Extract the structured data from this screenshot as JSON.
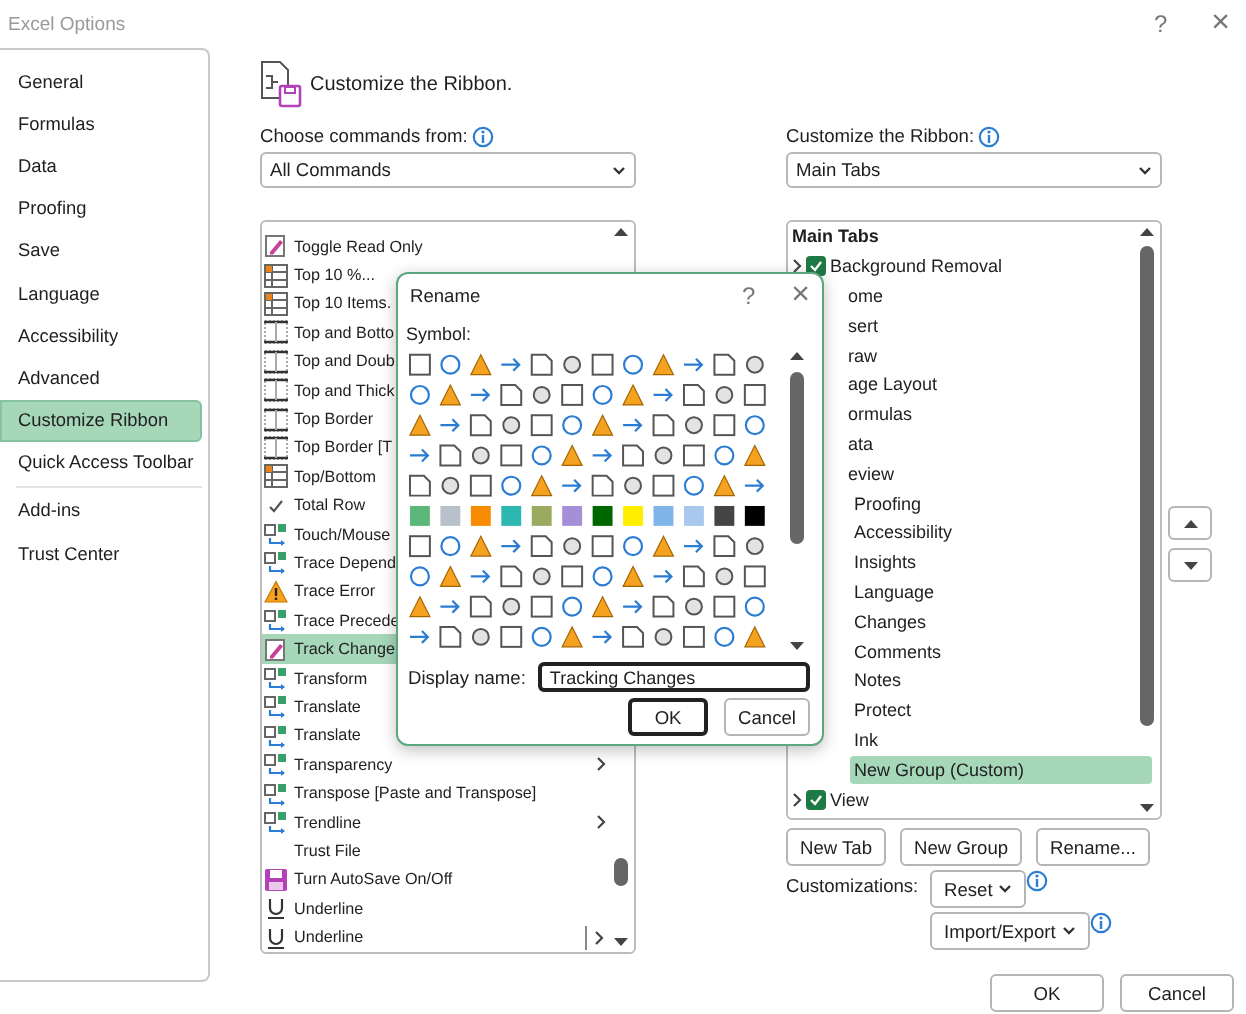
{
  "window": {
    "title": "Excel Options",
    "help": "?",
    "close": "×"
  },
  "sidebar": {
    "sections": [
      {
        "items": [
          {
            "label": "General",
            "selected": false
          },
          {
            "label": "Formulas",
            "selected": false
          },
          {
            "label": "Data",
            "selected": false
          },
          {
            "label": "Proofing",
            "selected": false
          },
          {
            "label": "Save",
            "selected": false
          },
          {
            "label": "Language",
            "selected": false
          },
          {
            "label": "Accessibility",
            "selected": false
          },
          {
            "label": "Advanced",
            "selected": false
          },
          {
            "label": "Customize Ribbon",
            "selected": true
          },
          {
            "label": "Quick Access Toolbar",
            "selected": false
          }
        ]
      },
      {
        "items": [
          {
            "label": "Add-ins",
            "selected": false
          },
          {
            "label": "Trust Center",
            "selected": false
          }
        ]
      }
    ]
  },
  "heading": "Customize the Ribbon.",
  "commands": {
    "label": "Choose commands from:",
    "dropdown": "All Commands",
    "items": [
      {
        "label": "Toggle Read Only",
        "kind": "pencil",
        "selected": false
      },
      {
        "label": "Top 10 %...",
        "kind": "table",
        "selected": false
      },
      {
        "label": "Top 10 Items.",
        "kind": "table",
        "selected": false
      },
      {
        "label": "Top and Botto",
        "kind": "border",
        "selected": false
      },
      {
        "label": "Top and Doub",
        "kind": "border",
        "selected": false
      },
      {
        "label": "Top and Thick",
        "kind": "border",
        "selected": false
      },
      {
        "label": "Top Border",
        "kind": "border",
        "selected": false
      },
      {
        "label": "Top Border [T",
        "kind": "border",
        "selected": false
      },
      {
        "label": "Top/Bottom",
        "kind": "table",
        "selected": false
      },
      {
        "label": "Total Row",
        "kind": "check",
        "selected": false
      },
      {
        "label": "Touch/Mouse",
        "kind": "arrows",
        "selected": false
      },
      {
        "label": "Trace Depend",
        "kind": "arrows",
        "selected": false
      },
      {
        "label": "Trace Error",
        "kind": "warning",
        "selected": false
      },
      {
        "label": "Trace Precede",
        "kind": "arrows",
        "selected": false
      },
      {
        "label": "Track Change",
        "kind": "pencil",
        "selected": true
      },
      {
        "label": "Transform",
        "kind": "arrows",
        "selected": false
      },
      {
        "label": "Translate",
        "kind": "arrows",
        "selected": false
      },
      {
        "label": "Translate",
        "kind": "arrows",
        "selected": false
      },
      {
        "label": "Transparency",
        "kind": "arrows",
        "selected": false,
        "submenu": true
      },
      {
        "label": "Transpose [Paste and Transpose]",
        "kind": "arrows",
        "selected": false
      },
      {
        "label": "Trendline",
        "kind": "arrows",
        "selected": false,
        "submenu": true
      },
      {
        "label": "Trust File",
        "kind": "none",
        "selected": false
      },
      {
        "label": "Turn AutoSave On/Off",
        "kind": "save",
        "selected": false
      },
      {
        "label": "Underline",
        "kind": "underline",
        "selected": false
      },
      {
        "label": "Underline",
        "kind": "underline",
        "selected": false,
        "split": true
      }
    ]
  },
  "ribbon": {
    "label": "Customize the Ribbon:",
    "dropdown": "Main Tabs",
    "header": "Main Tabs",
    "items": [
      {
        "kind": "tab",
        "label": "Background Removal",
        "checked": true,
        "selected": false
      },
      {
        "kind": "clipped",
        "label": "ome",
        "selected": false
      },
      {
        "kind": "clipped",
        "label": "sert",
        "selected": false
      },
      {
        "kind": "clipped",
        "label": "raw",
        "selected": false
      },
      {
        "kind": "clipped",
        "label": "age Layout",
        "selected": false
      },
      {
        "kind": "clipped",
        "label": "ormulas",
        "selected": false
      },
      {
        "kind": "clipped",
        "label": "ata",
        "selected": false
      },
      {
        "kind": "clipped",
        "label": "eview",
        "selected": false,
        "children": [
          {
            "kind": "group",
            "label": "Proofing",
            "selected": false
          },
          {
            "kind": "group",
            "label": "Accessibility",
            "selected": false
          },
          {
            "kind": "group",
            "label": "Insights",
            "selected": false
          },
          {
            "kind": "group",
            "label": "Language",
            "selected": false
          },
          {
            "kind": "group",
            "label": "Changes",
            "selected": false
          },
          {
            "kind": "group",
            "label": "Comments",
            "selected": false
          },
          {
            "kind": "group",
            "label": "Notes",
            "selected": false
          },
          {
            "kind": "group",
            "label": "Protect",
            "selected": false
          },
          {
            "kind": "group",
            "label": "Ink",
            "selected": false
          },
          {
            "kind": "group",
            "label": "New Group (Custom)",
            "selected": true
          }
        ]
      },
      {
        "kind": "tab",
        "label": "View",
        "checked": true,
        "selected": false
      }
    ],
    "buttons": [
      "New Tab",
      "New Group",
      "Rename..."
    ],
    "customizations_label": "Customizations:",
    "reset": "Reset",
    "import_export": "Import/Export"
  },
  "footer": {
    "buttons": [
      "OK",
      "Cancel"
    ]
  },
  "rename_dialog": {
    "title": "Rename",
    "help": "?",
    "close": "×",
    "symbol_label": "Symbol:",
    "display_name_label": "Display name:",
    "display_name": "Tracking Changes",
    "buttons": [
      "OK",
      "Cancel"
    ]
  }
}
